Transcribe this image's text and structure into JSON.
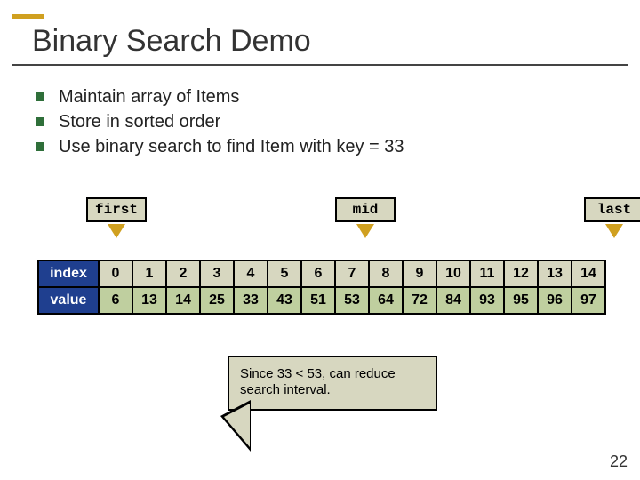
{
  "title": "Binary Search Demo",
  "bullets": [
    "Maintain array of Items",
    "Store in sorted order",
    "Use binary search to find Item with key = 33"
  ],
  "pointers": {
    "first": {
      "label": "first",
      "col": 0
    },
    "mid": {
      "label": "mid",
      "col": 7
    },
    "last": {
      "label": "last",
      "col": 14
    }
  },
  "table": {
    "index_label": "index",
    "value_label": "value",
    "indices": [
      "0",
      "1",
      "2",
      "3",
      "4",
      "5",
      "6",
      "7",
      "8",
      "9",
      "10",
      "11",
      "12",
      "13",
      "14"
    ],
    "values": [
      "6",
      "13",
      "14",
      "25",
      "33",
      "43",
      "51",
      "53",
      "64",
      "72",
      "84",
      "93",
      "95",
      "96",
      "97"
    ]
  },
  "callout": "Since 33 < 53, can reduce search interval.",
  "page_number": "22",
  "chart_data": {
    "type": "table",
    "title": "Binary Search Demo",
    "columns": [
      "index",
      "value"
    ],
    "rows": [
      [
        0,
        6
      ],
      [
        1,
        13
      ],
      [
        2,
        14
      ],
      [
        3,
        25
      ],
      [
        4,
        33
      ],
      [
        5,
        43
      ],
      [
        6,
        51
      ],
      [
        7,
        53
      ],
      [
        8,
        64
      ],
      [
        9,
        72
      ],
      [
        10,
        84
      ],
      [
        11,
        93
      ],
      [
        12,
        95
      ],
      [
        13,
        96
      ],
      [
        14,
        97
      ]
    ],
    "pointers": {
      "first": 0,
      "mid": 7,
      "last": 14
    },
    "search_key": 33,
    "annotation": "Since 33 < 53, can reduce search interval."
  }
}
